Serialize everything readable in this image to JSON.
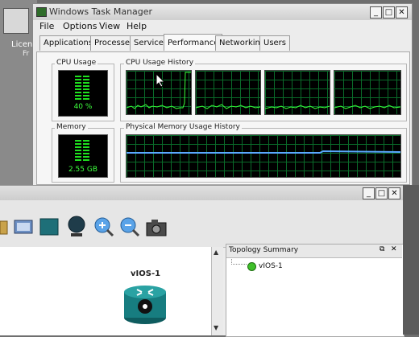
{
  "desktop": {
    "icon_label": "Licen",
    "icon_label2": "Fr"
  },
  "task_manager": {
    "title": "Windows Task Manager",
    "menu": [
      "File",
      "Options",
      "View",
      "Help"
    ],
    "tabs": [
      "Applications",
      "Processes",
      "Services",
      "Performance",
      "Networking",
      "Users"
    ],
    "active_tab": "Performance",
    "cpu_usage": {
      "label": "CPU Usage",
      "value": "40 %"
    },
    "cpu_history": {
      "label": "CPU Usage History"
    },
    "memory": {
      "label": "Memory",
      "value": "2.55 GB"
    },
    "memory_history": {
      "label": "Physical Memory Usage History"
    },
    "window_buttons": {
      "minimize": "_",
      "maximize": "□",
      "close": "✕"
    }
  },
  "gns": {
    "window_buttons": {
      "minimize": "_",
      "maximize": "□",
      "close": "✕"
    },
    "device": {
      "label": "vIOS-1"
    },
    "topology_summary": {
      "title": "Topology Summary",
      "items": [
        {
          "name": "vIOS-1",
          "status_color": "#3fbf2a"
        }
      ]
    },
    "toolbar_icons": [
      "snapshot-icon",
      "screenshot-icon",
      "chassis-icon",
      "device-icon",
      "zoom-in-icon",
      "zoom-out-icon",
      "camera-icon"
    ]
  }
}
